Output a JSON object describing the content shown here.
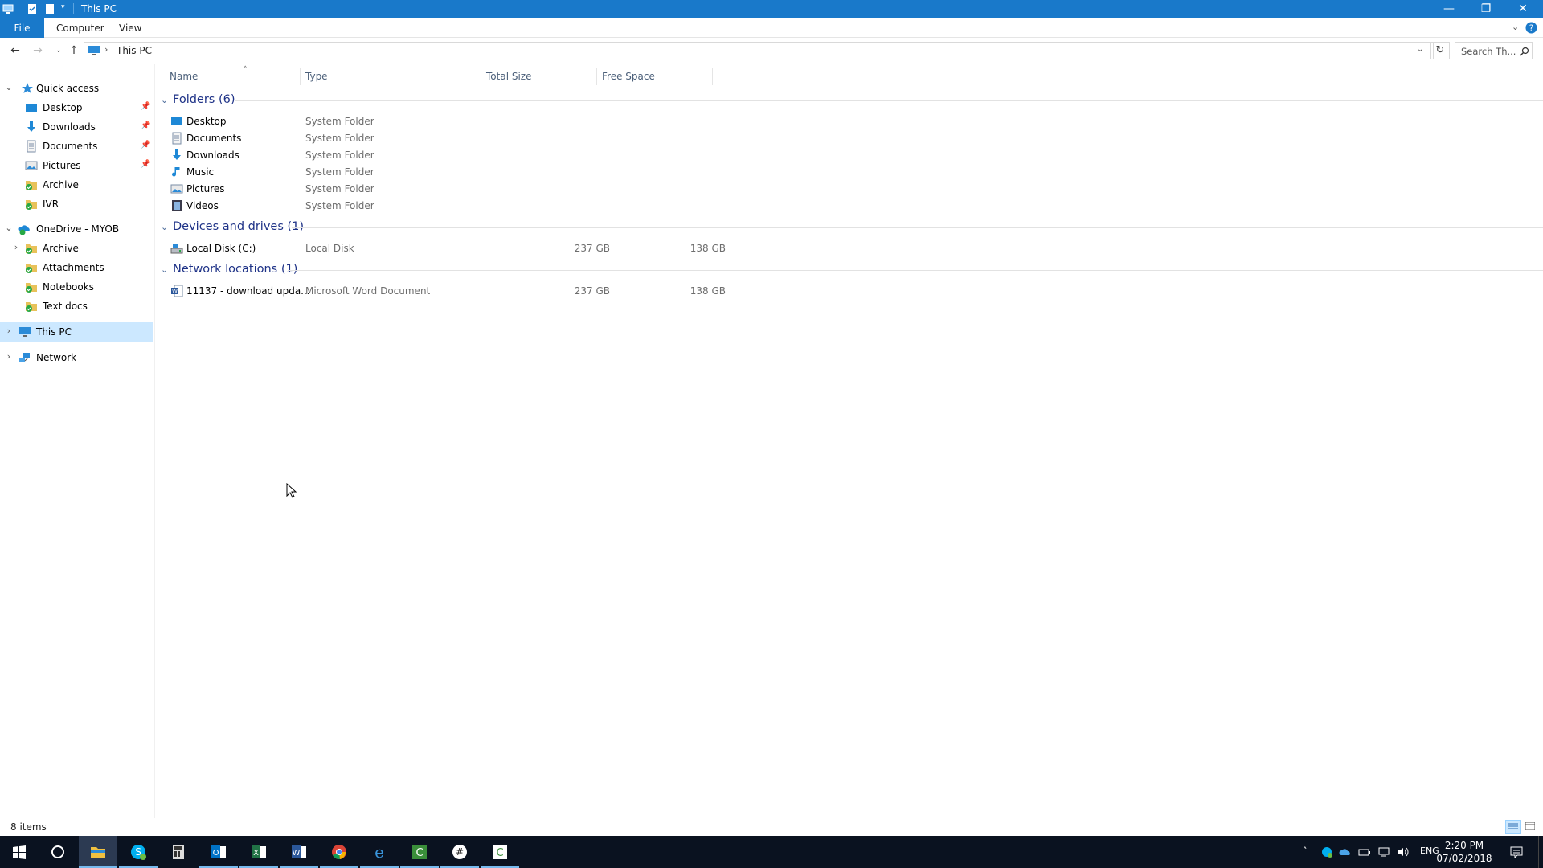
{
  "window": {
    "title": "This PC"
  },
  "ribbon": {
    "tabs": [
      "File",
      "Computer",
      "View"
    ]
  },
  "address": {
    "path": "This PC",
    "search_placeholder": "Search Th..."
  },
  "navpane": {
    "quick_access": {
      "label": "Quick access",
      "items": [
        {
          "label": "Desktop",
          "pinned": true,
          "icon": "desktop-icon"
        },
        {
          "label": "Downloads",
          "pinned": true,
          "icon": "downloads-icon"
        },
        {
          "label": "Documents",
          "pinned": true,
          "icon": "documents-icon"
        },
        {
          "label": "Pictures",
          "pinned": true,
          "icon": "pictures-icon"
        },
        {
          "label": "Archive",
          "pinned": false,
          "icon": "synced-folder-icon"
        },
        {
          "label": "IVR",
          "pinned": false,
          "icon": "synced-folder-icon"
        }
      ]
    },
    "onedrive": {
      "label": "OneDrive - MYOB",
      "items": [
        {
          "label": "Archive",
          "expandable": true
        },
        {
          "label": "Attachments",
          "expandable": false
        },
        {
          "label": "Notebooks",
          "expandable": false
        },
        {
          "label": "Text docs",
          "expandable": false
        }
      ]
    },
    "this_pc": {
      "label": "This PC",
      "selected": true
    },
    "network": {
      "label": "Network"
    }
  },
  "columns": {
    "name": "Name",
    "type": "Type",
    "total_size": "Total Size",
    "free_space": "Free Space"
  },
  "groups": {
    "folders": {
      "label": "Folders (6)",
      "items": [
        {
          "name": "Desktop",
          "type": "System Folder",
          "icon": "desktop-icon"
        },
        {
          "name": "Documents",
          "type": "System Folder",
          "icon": "documents-icon"
        },
        {
          "name": "Downloads",
          "type": "System Folder",
          "icon": "downloads-icon"
        },
        {
          "name": "Music",
          "type": "System Folder",
          "icon": "music-icon"
        },
        {
          "name": "Pictures",
          "type": "System Folder",
          "icon": "pictures-icon"
        },
        {
          "name": "Videos",
          "type": "System Folder",
          "icon": "videos-icon"
        }
      ]
    },
    "devices": {
      "label": "Devices and drives (1)",
      "items": [
        {
          "name": "Local Disk (C:)",
          "type": "Local Disk",
          "total": "237 GB",
          "free": "138 GB",
          "icon": "local-disk-icon"
        }
      ]
    },
    "network": {
      "label": "Network locations (1)",
      "items": [
        {
          "name": "11137 - download upda...",
          "type": "Microsoft Word Document",
          "total": "237 GB",
          "free": "138 GB",
          "icon": "word-document-icon"
        }
      ]
    }
  },
  "status": {
    "items_count": "8 items"
  },
  "taskbar": {
    "apps": [
      "start-icon",
      "cortana-icon",
      "file-explorer-icon",
      "skype-icon",
      "calculator-icon",
      "outlook-icon",
      "excel-icon",
      "word-icon",
      "chrome-icon",
      "edge-icon",
      "camtasia-icon",
      "slack-icon",
      "camtasia-recorder-icon"
    ],
    "language": "ENG",
    "time": "2:20 PM",
    "date": "07/02/2018"
  },
  "colors": {
    "accent": "#1979ca",
    "selected": "#cce8ff",
    "group_header": "#1e3287",
    "taskbar": "#0a1220"
  }
}
